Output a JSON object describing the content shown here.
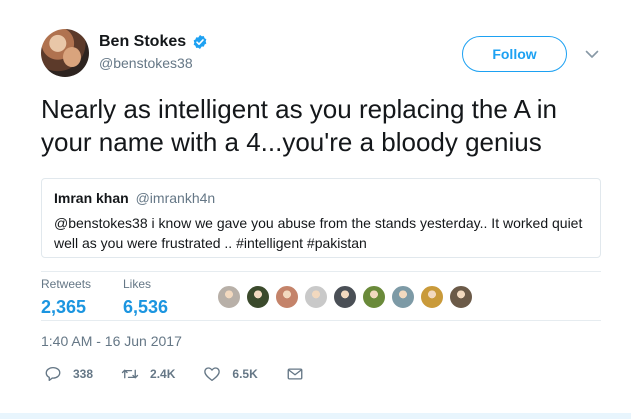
{
  "author": {
    "name": "Ben Stokes",
    "handle": "@benstokes38",
    "verified": true,
    "avatar_icon": "profile-photo"
  },
  "follow_button": {
    "label": "Follow"
  },
  "menu": {
    "icon": "chevron-down-icon"
  },
  "tweet": {
    "text": "Nearly as intelligent as you replacing the A in your name with a 4...you're a bloody genius"
  },
  "quoted_tweet": {
    "author_name": "Imran khan",
    "author_handle": "@imrankh4n",
    "text": "@benstokes38 i know we gave you abuse from the stands yesterday.. It worked quiet well as you were frustrated ..  #intelligent #pakistan"
  },
  "stats": {
    "retweets_label": "Retweets",
    "retweets_value": "2,365",
    "likes_label": "Likes",
    "likes_value": "6,536"
  },
  "likers": [
    {
      "color": "#b8b0a8"
    },
    {
      "color": "#3b4a2c"
    },
    {
      "color": "#c4836a"
    },
    {
      "color": "#c9c9c9"
    },
    {
      "color": "#4a4f56"
    },
    {
      "color": "#6a8a3a"
    },
    {
      "color": "#7d9aa6"
    },
    {
      "color": "#c99a3a"
    },
    {
      "color": "#6b5a48"
    }
  ],
  "timestamp": "1:40 AM - 16 Jun 2017",
  "actions": {
    "reply_count": "338",
    "retweet_count": "2.4K",
    "like_count": "6.5K"
  },
  "colors": {
    "accent": "#1da1f2",
    "stat_value": "#1b95e0",
    "muted": "#657786",
    "text": "#14171a"
  }
}
